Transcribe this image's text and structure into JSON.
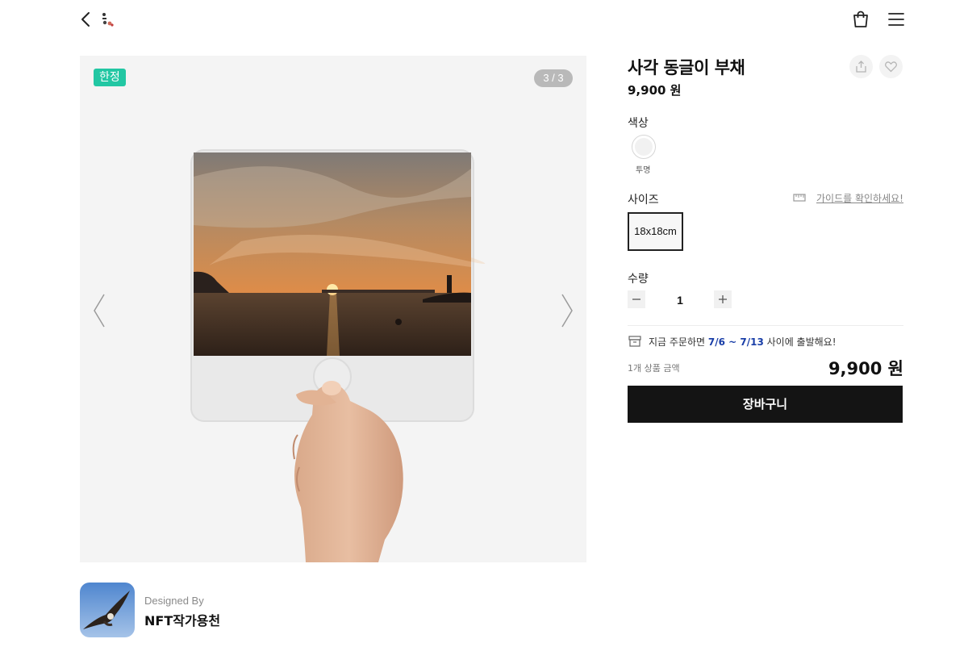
{
  "header": {
    "back_icon": "chevron-left-icon",
    "cart_icon": "shopping-bag-icon",
    "menu_icon": "hamburger-menu-icon"
  },
  "gallery": {
    "badge": "한정",
    "counter": "3 / 3",
    "current_index": 3,
    "total": 3,
    "prev_icon": "chevron-left-icon",
    "next_icon": "chevron-right-icon"
  },
  "designer": {
    "label": "Designed By",
    "name": "NFT작가용천"
  },
  "product": {
    "title": "사각 동글이 부채",
    "price": "9,900 원"
  },
  "options": {
    "color_label": "색상",
    "color_value": "투명",
    "size_label": "사이즈",
    "guide_link": "가이드를 확인하세요!",
    "size_value": "18x18cm",
    "quantity_label": "수량",
    "quantity": "1"
  },
  "shipping": {
    "prefix": "지금 주문하면 ",
    "dates": "7/6 ~ 7/13",
    "suffix": " 사이에 출발해요!"
  },
  "total": {
    "label": "1개 상품 금액",
    "price": "9,900 원"
  },
  "actions": {
    "cart_button": "장바구니"
  },
  "colors": {
    "badge": "#22c7a3",
    "button": "#141414",
    "ship_date": "#1a3fa8"
  }
}
